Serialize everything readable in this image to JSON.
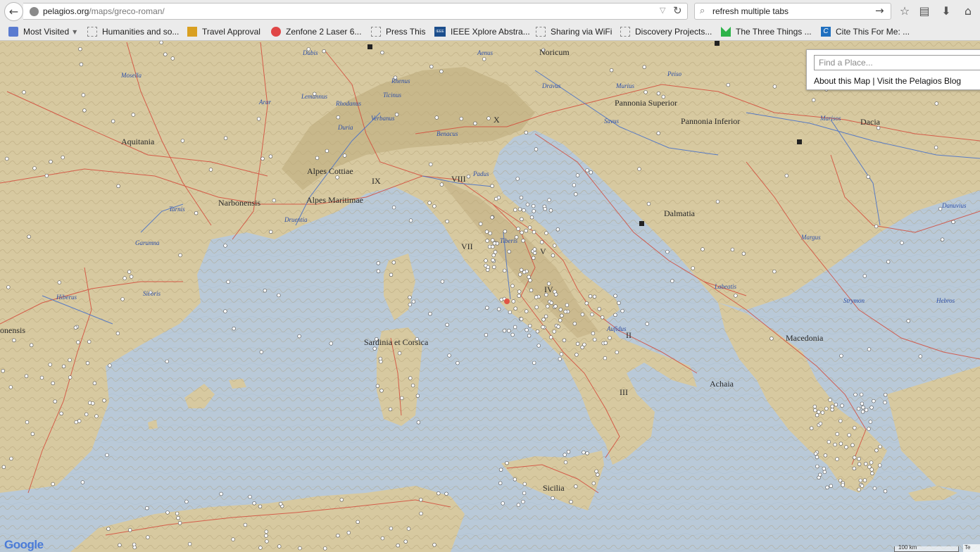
{
  "browser": {
    "url_domain": "pelagios.org",
    "url_path": "/maps/greco-roman/",
    "search_value": "refresh multiple tabs",
    "icons": [
      "back-arrow-icon",
      "globe-icon",
      "dropdown-arrow-icon",
      "reload-icon",
      "search-icon",
      "search-go-icon",
      "bookmark-star-icon",
      "reading-list-icon",
      "download-icon",
      "home-icon"
    ]
  },
  "bookmarks": [
    {
      "label": "Most Visited",
      "icon": "folder-icon",
      "color": "#5a7bd0"
    },
    {
      "label": "Humanities and so...",
      "icon": "blank-page-icon"
    },
    {
      "label": "Travel Approval",
      "icon": "travel-icon",
      "color": "#d9a021"
    },
    {
      "label": "Zenfone 2 Laser 6...",
      "icon": "zenfone-icon",
      "color": "#e04646"
    },
    {
      "label": "Press This",
      "icon": "blank-page-icon"
    },
    {
      "label": "IEEE Xplore Abstra...",
      "icon": "ieee-icon",
      "color": "#1c4e8c",
      "icon_text": "IEEE"
    },
    {
      "label": "Sharing via WiFi",
      "icon": "blank-page-icon"
    },
    {
      "label": "Discovery Projects...",
      "icon": "blank-page-icon"
    },
    {
      "label": "The Three Things ...",
      "icon": "three-things-icon",
      "color": "#2db34a"
    },
    {
      "label": "Cite This For Me: ...",
      "icon": "cite-icon",
      "color": "#1f6fbf",
      "icon_text": "C"
    }
  ],
  "map": {
    "search_placeholder": "Find a Place...",
    "about_link": "About this Map",
    "separator": "|",
    "blog_link": "Visit the Pelagios Blog",
    "provider_logo": "Google",
    "scale_label": "100 km",
    "terms_label": "Te",
    "colors": {
      "sea": "#b9c9d8",
      "land": "#d7c9a0",
      "roads": "#d44a3a",
      "rivers": "#2d4fa8"
    },
    "regions": [
      "Noricum",
      "Pannonia Superior",
      "Pannonia Inferior",
      "Dacia",
      "Aquitania",
      "Alpes Cottiae",
      "Narbonensis",
      "Alpes Maritimae",
      "Dalmatia",
      "Macedonia",
      "Sardinia et Corsica",
      "Achaia",
      "Sicilia",
      "onensis"
    ],
    "italian_regions": [
      "X",
      "IX",
      "VIII",
      "VII",
      "V",
      "IV",
      "II",
      "III"
    ],
    "rivers": [
      "Dubis",
      "Aenus",
      "Lemannus",
      "Rhenus",
      "Ticinus",
      "Rhodanus",
      "Verbanus",
      "Duria",
      "Benacus",
      "Dravus",
      "Murius",
      "Peiso",
      "Savus",
      "Marisos",
      "Arar",
      "Tarnis",
      "Druentia",
      "Garumna",
      "Sicoris",
      "Hiberus",
      "Tiberis",
      "Aufidus",
      "Labeatis",
      "Margus",
      "Strymon",
      "Hebros",
      "Danuvius",
      "Padus",
      "Mosella"
    ]
  }
}
